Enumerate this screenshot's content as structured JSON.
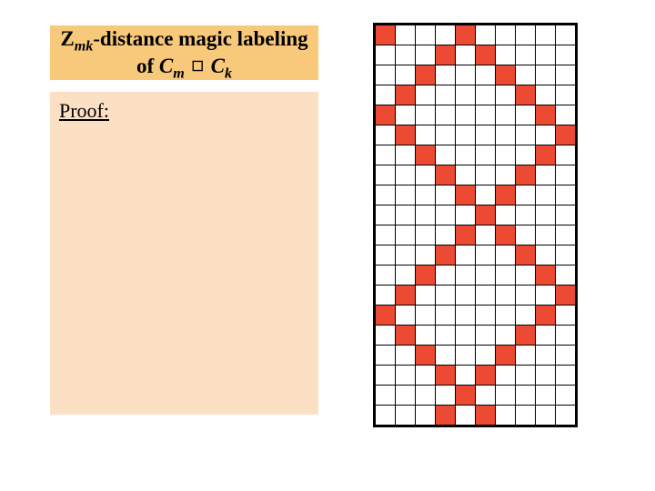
{
  "title": {
    "plain_line1": "Zmk-distance magic labeling",
    "plain_line2": "of Cm □ Ck"
  },
  "proof": {
    "label": "Proof:"
  },
  "grid": {
    "rows": 20,
    "cols": 10,
    "filled": [
      [
        0,
        0
      ],
      [
        0,
        4
      ],
      [
        1,
        3
      ],
      [
        1,
        5
      ],
      [
        2,
        2
      ],
      [
        2,
        6
      ],
      [
        3,
        1
      ],
      [
        3,
        7
      ],
      [
        4,
        0
      ],
      [
        4,
        8
      ],
      [
        5,
        1
      ],
      [
        5,
        9
      ],
      [
        6,
        2
      ],
      [
        6,
        8
      ],
      [
        7,
        3
      ],
      [
        7,
        7
      ],
      [
        8,
        4
      ],
      [
        8,
        6
      ],
      [
        9,
        5
      ],
      [
        10,
        4
      ],
      [
        10,
        6
      ],
      [
        11,
        3
      ],
      [
        11,
        7
      ],
      [
        12,
        2
      ],
      [
        12,
        8
      ],
      [
        13,
        1
      ],
      [
        13,
        9
      ],
      [
        14,
        0
      ],
      [
        14,
        8
      ],
      [
        15,
        1
      ],
      [
        15,
        7
      ],
      [
        16,
        2
      ],
      [
        16,
        6
      ],
      [
        17,
        3
      ],
      [
        17,
        5
      ],
      [
        18,
        4
      ],
      [
        19,
        3
      ],
      [
        19,
        5
      ]
    ]
  },
  "colors": {
    "title_bg": "#f8c97a",
    "proof_bg": "#fbe0c4",
    "cell_fill": "#ec4a33",
    "cell_empty": "#ffffff",
    "grid_line": "#000000"
  }
}
